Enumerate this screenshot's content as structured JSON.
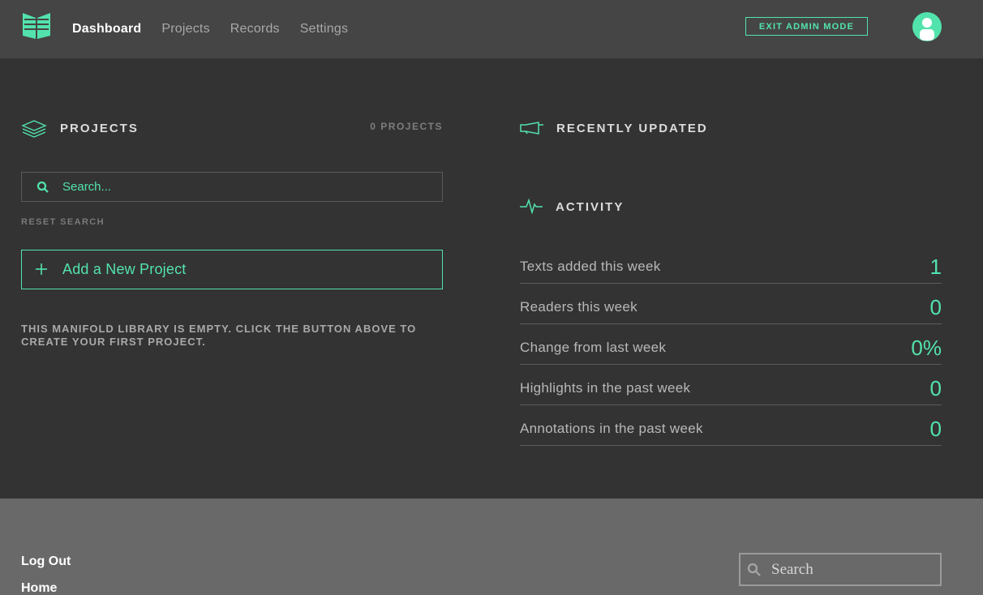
{
  "colors": {
    "accent": "#52e3ac",
    "header_bg": "#454545",
    "body_bg": "#333333",
    "footer_bg": "#696969"
  },
  "header": {
    "logo_icon": "manifold-logo-icon",
    "nav": [
      {
        "label": "Dashboard",
        "active": true
      },
      {
        "label": "Projects",
        "active": false
      },
      {
        "label": "Records",
        "active": false
      },
      {
        "label": "Settings",
        "active": false
      }
    ],
    "exit_admin_label": "EXIT ADMIN MODE",
    "avatar_icon": "user-avatar-icon"
  },
  "projects": {
    "title": "PROJECTS",
    "icon": "layers-icon",
    "count_label": "0 PROJECTS",
    "search_placeholder": "Search...",
    "search_icon": "search-icon",
    "reset_label": "RESET SEARCH",
    "add_label": "Add a New Project",
    "add_icon": "plus-icon",
    "empty_message": "THIS MANIFOLD LIBRARY IS EMPTY. CLICK THE BUTTON ABOVE TO CREATE YOUR FIRST PROJECT."
  },
  "recently_updated": {
    "title": "RECENTLY UPDATED",
    "icon": "megaphone-icon"
  },
  "activity": {
    "title": "ACTIVITY",
    "icon": "pulse-icon",
    "rows": [
      {
        "label": "Texts added this week",
        "value": "1"
      },
      {
        "label": "Readers this week",
        "value": "0"
      },
      {
        "label": "Change from last week",
        "value": "0%"
      },
      {
        "label": "Highlights in the past week",
        "value": "0"
      },
      {
        "label": "Annotations in the past week",
        "value": "0"
      }
    ]
  },
  "footer": {
    "links": [
      "Log Out",
      "Home"
    ],
    "search_placeholder": "Search",
    "search_icon": "search-icon"
  }
}
